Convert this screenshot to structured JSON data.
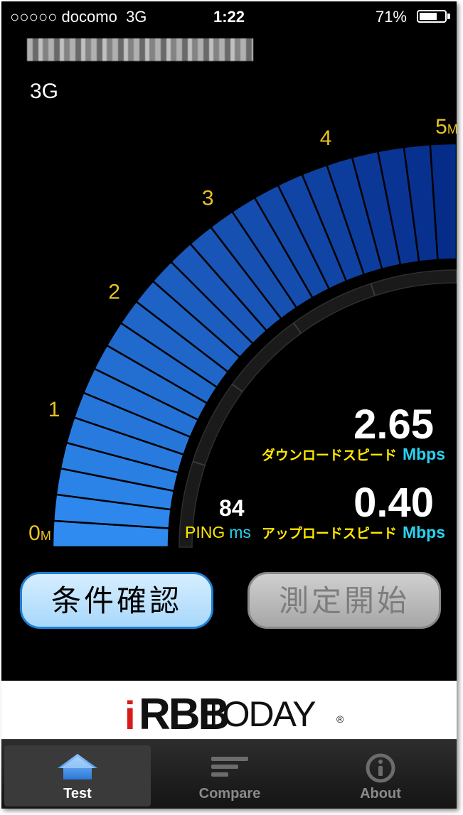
{
  "status_bar": {
    "carrier": "○○○○○ docomo",
    "network": "3G",
    "time": "1:22",
    "battery_percent": "71%",
    "battery_level": 0.71
  },
  "connection": {
    "network_type": "3G"
  },
  "gauge": {
    "ticks": [
      "0M",
      "1",
      "2",
      "3",
      "4",
      "5M"
    ],
    "max_mbps": 5,
    "current_mbps": 2.65
  },
  "download": {
    "value": "2.65",
    "label": "ダウンロードスピード",
    "unit": "Mbps"
  },
  "upload": {
    "value": "0.40",
    "label": "アップロードスピード",
    "unit": "Mbps"
  },
  "ping": {
    "value": "84",
    "label": "PING",
    "unit": "ms"
  },
  "buttons": {
    "conditions": "条件確認",
    "start": "測定開始"
  },
  "banner": {
    "logo_i": "i",
    "logo_bb": "RBB",
    "logo_today": "TODAY",
    "logo_reg": "®"
  },
  "tabs": [
    {
      "label": "Test",
      "icon": "home-icon",
      "selected": true
    },
    {
      "label": "Compare",
      "icon": "bars-icon",
      "selected": false
    },
    {
      "label": "About",
      "icon": "info-icon",
      "selected": false
    }
  ],
  "colors": {
    "gauge_light": "#2f8bf0",
    "gauge_dark": "#062c8a",
    "tick": "#e8c21e",
    "label_yellow": "#ffe800",
    "unit_cyan": "#28d3f2",
    "button_active_border": "#1e7fd6"
  }
}
